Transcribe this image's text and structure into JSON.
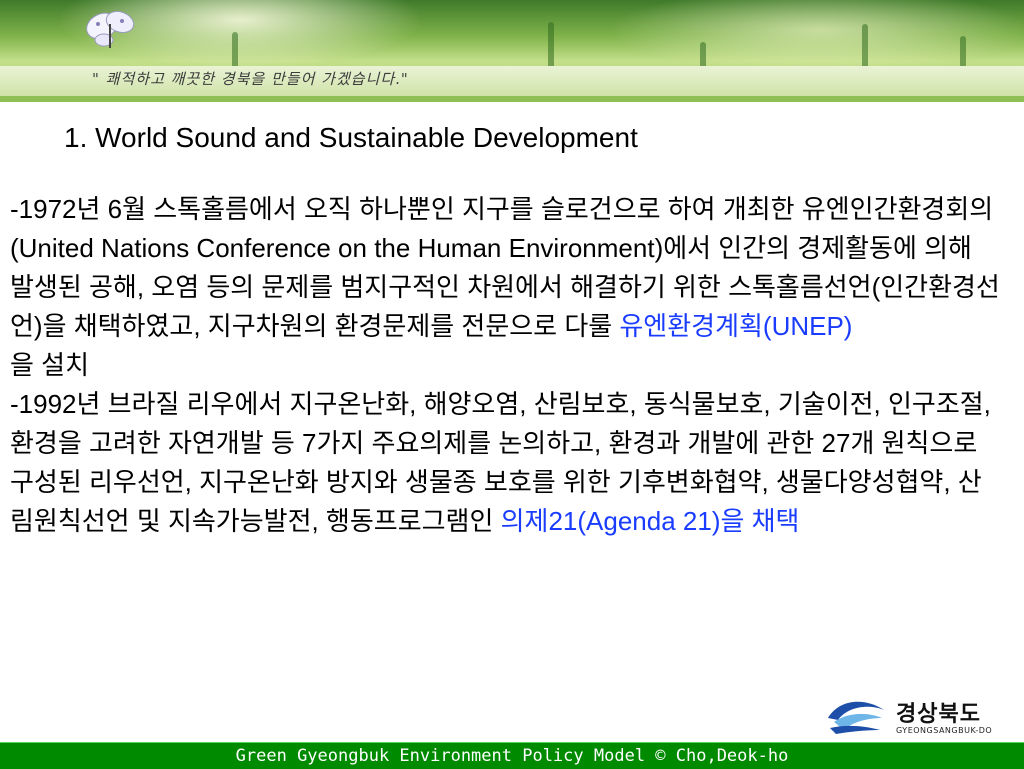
{
  "header": {
    "slogan": "\" 쾌적하고 깨끗한 경북을 만들어 가겠습니다.\""
  },
  "slide": {
    "heading": "1. World Sound and Sustainable Development",
    "para1": {
      "text": "-1972년 6월 스톡홀름에서 오직 하나뿐인 지구를 슬로건으로 하여 개최한 유엔인간환경회의(United Nations Conference on the Human Environment)에서 인간의 경제활동에 의해 발생된 공해, 오염 등의 문제를 범지구적인 차원에서 해결하기 위한 스톡홀름선언(인간환경선언)을 채택하였고, 지구차원의 환경문제를 전문으로 다룰 ",
      "highlight": "유엔환경계획(UNEP)",
      "tail": "을 설치"
    },
    "para2": {
      "text": "-1992년 브라질 리우에서 지구온난화, 해양오염, 산림보호, 동식물보호, 기술이전, 인구조절, 환경을 고려한 자연개발 등 7가지 주요의제를 논의하고, 환경과 개발에 관한 27개 원칙으로 구성된 리우선언, 지구온난화 방지와 생물종 보호를 위한 기후변화협약, 생물다양성협약, 산림원칙선언 및 지속가능발전, 행동프로그램인 ",
      "highlight": "의제21(Agenda 21)을 채택"
    }
  },
  "logo": {
    "title": "경상북도",
    "subtitle": "GYEONGSANGBUK-DO",
    "colors": {
      "blue": "#1e4fa8",
      "light_blue": "#6fb6e8"
    }
  },
  "footer": {
    "text": "Green Gyeongbuk Environment Policy Model © Cho,Deok-ho",
    "bg_color": "#008a00"
  },
  "colors": {
    "highlight": "#1a3cff"
  }
}
